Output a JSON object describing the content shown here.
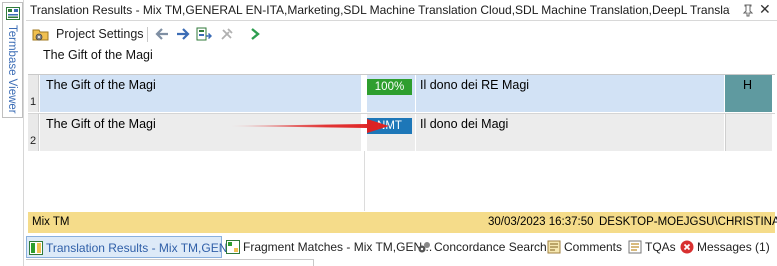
{
  "side": {
    "tab_label": "Termbase Viewer"
  },
  "panel": {
    "title": "Translation Results - Mix TM,GENERAL EN-ITA,Marketing,SDL Machine Translation Cloud,SDL Machine Translation,DeepL Translator pro..."
  },
  "toolbar": {
    "project_settings_label": "Project Settings"
  },
  "source_text": "The Gift of the Magi",
  "results": [
    {
      "number": "1",
      "source": "The Gift of the Magi",
      "match": "100%",
      "match_color": "#2e9e2e",
      "target": "Il dono dei RE Magi",
      "flag": "H"
    },
    {
      "number": "2",
      "source": "The Gift of the Magi",
      "match": "NMT",
      "match_color": "#1d77b8",
      "target": "Il dono dei Magi",
      "flag": ""
    }
  ],
  "status": {
    "origin": "Mix TM",
    "date": "30/03/2023 16:37:50",
    "user": "DESKTOP-MOEJGSU\\CHRISTINA"
  },
  "tabs": [
    {
      "label": "Translation Results - Mix TM,GEN...",
      "icon": "translation-results-icon",
      "active": true
    },
    {
      "label": "Fragment Matches - Mix TM,GEN...",
      "icon": "fragment-matches-icon",
      "active": false
    },
    {
      "label": "Concordance Search",
      "icon": "concordance-icon",
      "active": false
    },
    {
      "label": "Comments",
      "icon": "comments-icon",
      "active": false
    },
    {
      "label": "TQAs",
      "icon": "tqa-icon",
      "active": false
    },
    {
      "label": "Messages (1)",
      "icon": "messages-error-icon",
      "active": false
    }
  ],
  "colors": {
    "accent": "#2f5fa8",
    "status_bar": "#f5dc8a",
    "row_selected": "#d2e2f5",
    "arrow": "#e02020"
  }
}
